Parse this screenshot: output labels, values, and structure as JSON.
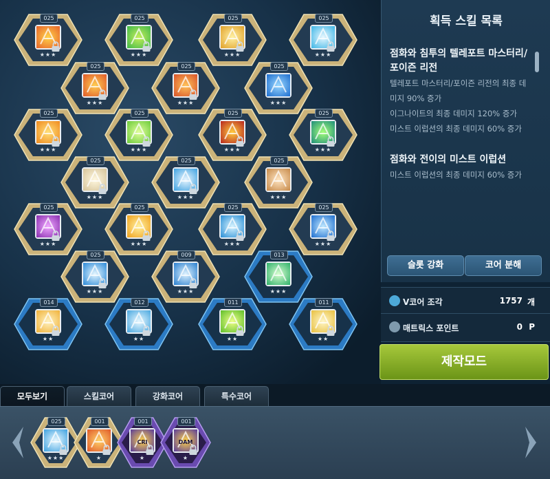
{
  "colors": {
    "accent_green": "#8fb82a",
    "panel": "#1b3349",
    "hex_gold": "#c9b27a",
    "hex_blue": "#2c7bc4",
    "hex_purple": "#5a3d9a"
  },
  "grid_cores": [
    {
      "name": "core-1",
      "level": "025",
      "frame": "gold",
      "icon": "fire-slash-icon",
      "c1": "#e8652b",
      "c2": "#ffd34a",
      "locked": true,
      "stars": 3
    },
    {
      "name": "core-2",
      "level": "025",
      "frame": "gold",
      "icon": "green-slash-icon",
      "c1": "#42b94b",
      "c2": "#c6ef5a",
      "locked": true,
      "stars": 3
    },
    {
      "name": "core-3",
      "level": "025",
      "frame": "gold",
      "icon": "gold-slash-icon",
      "c1": "#e1a12a",
      "c2": "#fff2a6",
      "locked": true,
      "stars": 3
    },
    {
      "name": "core-4",
      "level": "025",
      "frame": "gold",
      "icon": "ice-slash-icon",
      "c1": "#3fb6e6",
      "c2": "#e8f8ff",
      "locked": true,
      "stars": 3
    },
    {
      "name": "core-5",
      "level": "025",
      "frame": "gold",
      "icon": "fire-slash-icon",
      "c1": "#e05a2a",
      "c2": "#ffce52",
      "locked": true,
      "stars": 3
    },
    {
      "name": "core-6",
      "level": "025",
      "frame": "gold",
      "icon": "fire-slash-icon",
      "c1": "#d9532a",
      "c2": "#ffc35a",
      "locked": true,
      "stars": 3
    },
    {
      "name": "core-7",
      "level": "025",
      "frame": "gold",
      "icon": "book-icon",
      "c1": "#1f6fd0",
      "c2": "#9ad8ff",
      "locked": false,
      "stars": 3
    },
    {
      "name": "core-8",
      "level": "025",
      "frame": "gold",
      "icon": "fire-orb-icon",
      "c1": "#f08a1e",
      "c2": "#ffe17a",
      "locked": true,
      "stars": 3
    },
    {
      "name": "core-9",
      "level": "025",
      "frame": "gold",
      "icon": "green-orb-icon",
      "c1": "#6ccb3a",
      "c2": "#e2ff9c",
      "locked": true,
      "stars": 3
    },
    {
      "name": "core-10",
      "level": "025",
      "frame": "gold",
      "icon": "fire-pillar-icon",
      "c1": "#b8281f",
      "c2": "#ffcc3f",
      "locked": true,
      "stars": 3
    },
    {
      "name": "core-11",
      "level": "025",
      "frame": "gold",
      "icon": "green-rune-icon",
      "c1": "#1f8f7a",
      "c2": "#a6ff7a",
      "locked": true,
      "stars": 3
    },
    {
      "name": "core-12",
      "level": "025",
      "frame": "gold",
      "icon": "spirit-icon",
      "c1": "#d6c49a",
      "c2": "#fff8e0",
      "locked": true,
      "stars": 3
    },
    {
      "name": "core-13",
      "level": "025",
      "frame": "gold",
      "icon": "runner-icon",
      "c1": "#3fa2e0",
      "c2": "#eaf6ff",
      "locked": true,
      "stars": 3
    },
    {
      "name": "core-14",
      "level": "025",
      "frame": "gold",
      "icon": "character-icon",
      "c1": "#c78a4a",
      "c2": "#ffe6c4",
      "locked": false,
      "stars": 3
    },
    {
      "name": "core-15",
      "level": "025",
      "frame": "gold",
      "icon": "eye-icon",
      "c1": "#8a2fb0",
      "c2": "#f0a8ff",
      "locked": true,
      "stars": 3
    },
    {
      "name": "core-16",
      "level": "025",
      "frame": "gold",
      "icon": "sun-icon",
      "c1": "#f0a21e",
      "c2": "#fff1a0",
      "locked": true,
      "stars": 3
    },
    {
      "name": "core-17",
      "level": "025",
      "frame": "gold",
      "icon": "ice-wing-icon",
      "c1": "#2a8fd6",
      "c2": "#d8f4ff",
      "locked": true,
      "stars": 3
    },
    {
      "name": "core-18",
      "level": "025",
      "frame": "gold",
      "icon": "target-icon",
      "c1": "#1f6fd0",
      "c2": "#bfe8ff",
      "locked": true,
      "stars": 3
    },
    {
      "name": "core-19",
      "level": "025",
      "frame": "gold",
      "icon": "ice-spark-icon",
      "c1": "#2c8ad8",
      "c2": "#e4f6ff",
      "locked": true,
      "stars": 3
    },
    {
      "name": "core-20",
      "level": "009",
      "frame": "gold",
      "icon": "ice-dragon-icon",
      "c1": "#2a7fcf",
      "c2": "#dff3ff",
      "locked": true,
      "stars": 3
    },
    {
      "name": "core-21",
      "level": "013",
      "frame": "blue",
      "icon": "green-circle-icon",
      "c1": "#2fb06a",
      "c2": "#d8ffd0",
      "locked": false,
      "stars": 3
    },
    {
      "name": "core-22",
      "level": "014",
      "frame": "blue",
      "icon": "sun-burst-icon",
      "c1": "#f0b23a",
      "c2": "#fff2c0",
      "locked": true,
      "stars": 2
    },
    {
      "name": "core-23",
      "level": "012",
      "frame": "blue",
      "icon": "ice-flow-icon",
      "c1": "#4aa8e0",
      "c2": "#e8f8ff",
      "locked": true,
      "stars": 2
    },
    {
      "name": "core-24",
      "level": "011",
      "frame": "blue",
      "icon": "green-eye-icon",
      "c1": "#5fbf2a",
      "c2": "#f0ff8a",
      "locked": true,
      "stars": 2
    },
    {
      "name": "core-25",
      "level": "011",
      "frame": "blue",
      "icon": "light-burst-icon",
      "c1": "#e8c040",
      "c2": "#fff6c8",
      "locked": true,
      "stars": 2
    }
  ],
  "panel": {
    "title": "획득 스킬 목록",
    "skills": [
      {
        "name": "점화와 침투의 텔레포트 마스터리/포이즌 리전",
        "effects": [
          "텔레포트 마스터리/포이즌 리전의 최종 데미지 90% 증가",
          "이그나이트의 최종 데미지 120% 증가",
          "미스트 이럽션의 최종 데미지 60% 증가"
        ]
      },
      {
        "name": "점화와 전이의 미스트 이럽션",
        "effects": [
          "미스트 이럽션의 최종 데미지 60% 증가"
        ]
      }
    ],
    "slot_button": "슬롯 강화",
    "disassemble_button": "코어 분해"
  },
  "resources": {
    "vcore_label": "V코어 조각",
    "vcore_value": "1757",
    "vcore_unit": "개",
    "matrix_label": "매트릭스 포인트",
    "matrix_value": "0",
    "matrix_unit": "P"
  },
  "make_button": "제작모드",
  "tabs": [
    "모두보기",
    "스킬코어",
    "강화코어",
    "특수코어"
  ],
  "tray_cores": [
    {
      "name": "tray-core-1",
      "level": "025",
      "frame": "gold",
      "icon": "star-crest-icon",
      "c1": "#3fa2e0",
      "c2": "#e8f8ff",
      "locked": true,
      "stars": 3
    },
    {
      "name": "tray-core-2",
      "level": "001",
      "frame": "gold",
      "icon": "flame-spirit-icon",
      "c1": "#e05a2a",
      "c2": "#ffd36a",
      "locked": true,
      "stars": 1
    },
    {
      "name": "tray-core-3",
      "level": "001",
      "frame": "purple",
      "icon": "cri-icon",
      "c1": "#5a3d9a",
      "c2": "#ffd34a",
      "locked": true,
      "stars": 1,
      "label": "CRI"
    },
    {
      "name": "tray-core-4",
      "level": "001",
      "frame": "purple",
      "icon": "dam-icon",
      "c1": "#5a3d9a",
      "c2": "#ffd34a",
      "locked": true,
      "stars": 1,
      "label": "DAM"
    }
  ]
}
